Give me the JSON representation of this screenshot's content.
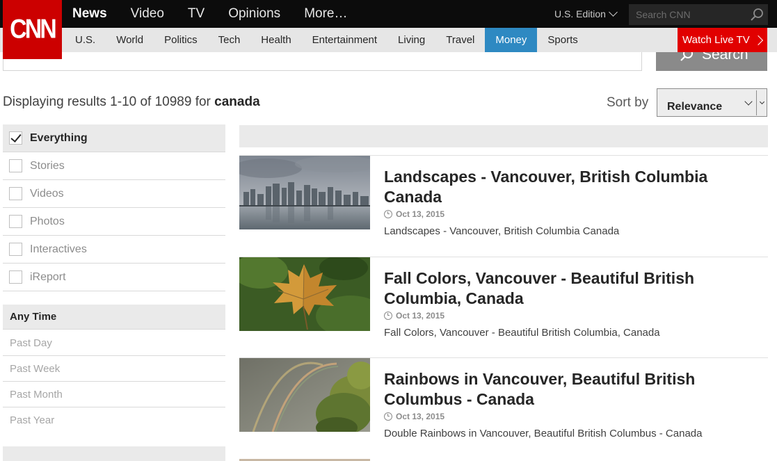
{
  "header": {
    "logo": "CNN",
    "top_nav": [
      "News",
      "Video",
      "TV",
      "Opinions",
      "More…"
    ],
    "edition": "U.S. Edition",
    "search_placeholder": "Search CNN",
    "sub_nav": [
      "U.S.",
      "World",
      "Politics",
      "Tech",
      "Health",
      "Entertainment",
      "Living",
      "Travel",
      "Money",
      "Sports"
    ],
    "watch_live": "Watch Live TV"
  },
  "search": {
    "button": "Search"
  },
  "summary": {
    "prefix": "Displaying results 1-10 of 10989 for",
    "query": "canada"
  },
  "sort": {
    "label": "Sort by",
    "value": "Relevance"
  },
  "filters": {
    "types": [
      {
        "label": "Everything",
        "checked": true
      },
      {
        "label": "Stories",
        "checked": false
      },
      {
        "label": "Videos",
        "checked": false
      },
      {
        "label": "Photos",
        "checked": false
      },
      {
        "label": "Interactives",
        "checked": false
      },
      {
        "label": "iReport",
        "checked": false
      }
    ],
    "time_heading": "Any Time",
    "times": [
      "Past Day",
      "Past Week",
      "Past Month",
      "Past Year"
    ]
  },
  "results": [
    {
      "title": "Landscapes - Vancouver, British Columbia Canada",
      "date": "Oct 13, 2015",
      "desc": "Landscapes - Vancouver, British Columbia Canada",
      "thumb": "vancouver-skyline"
    },
    {
      "title": "Fall Colors, Vancouver - Beautiful British Columbia, Canada",
      "date": "Oct 13, 2015",
      "desc": "Fall Colors, Vancouver - Beautiful British Columbia, Canada",
      "thumb": "maple-leaf"
    },
    {
      "title": "Rainbows in Vancouver, Beautiful British Columbus - Canada",
      "date": "Oct 13, 2015",
      "desc": "Double Rainbows in Vancouver, Beautiful British Columbus - Canada",
      "thumb": "double-rainbow"
    }
  ],
  "colors": {
    "brand_red": "#cc0000",
    "money_blue": "#2e89c2",
    "live_red": "#e10000"
  }
}
